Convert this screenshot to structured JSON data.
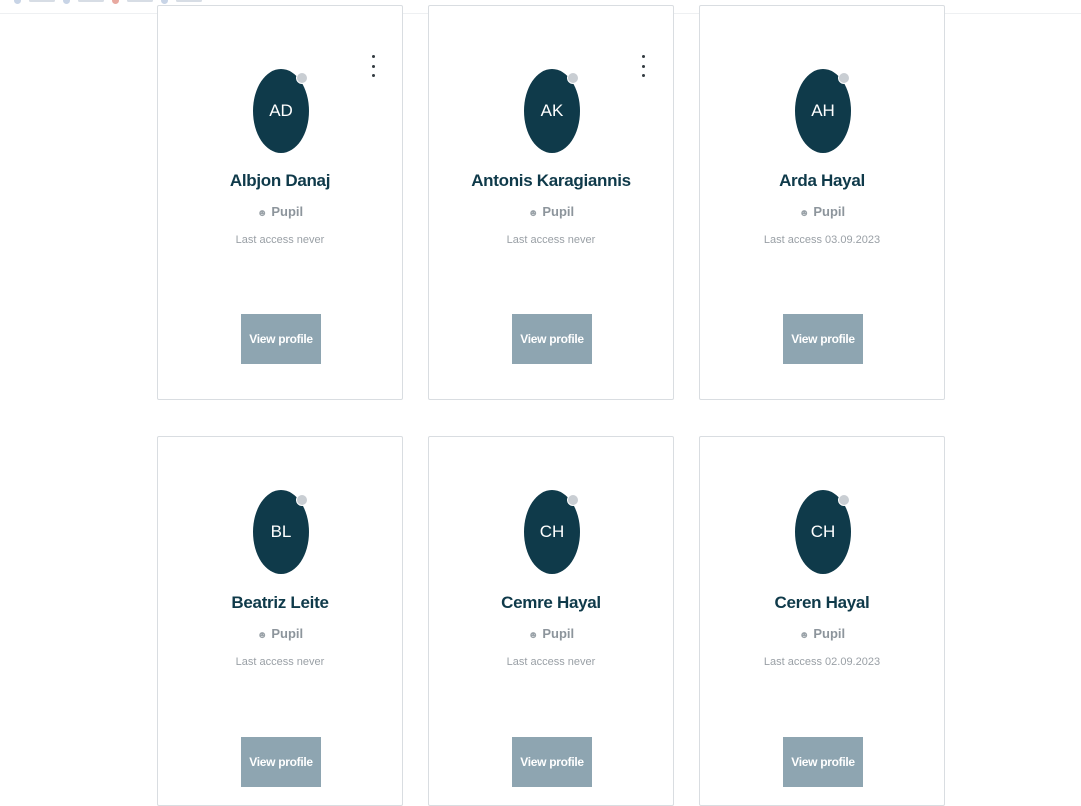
{
  "cards": [
    {
      "initials": "AD",
      "name": "Albjon Danaj",
      "role": "Pupil",
      "last_access": "Last access never",
      "button": "View profile",
      "has_menu": true
    },
    {
      "initials": "AK",
      "name": "Antonis Karagiannis",
      "role": "Pupil",
      "last_access": "Last access never",
      "button": "View profile",
      "has_menu": true
    },
    {
      "initials": "AH",
      "name": "Arda Hayal",
      "role": "Pupil",
      "last_access": "Last access 03.09.2023",
      "button": "View profile",
      "has_menu": false
    },
    {
      "initials": "BL",
      "name": "Beatriz Leite",
      "role": "Pupil",
      "last_access": "Last access never",
      "button": "View profile",
      "has_menu": false
    },
    {
      "initials": "CH",
      "name": "Cemre Hayal",
      "role": "Pupil",
      "last_access": "Last access never",
      "button": "View profile",
      "has_menu": false
    },
    {
      "initials": "CH",
      "name": "Ceren Hayal",
      "role": "Pupil",
      "last_access": "Last access 02.09.2023",
      "button": "View profile",
      "has_menu": false
    }
  ],
  "colors": {
    "avatar_bg": "#0f3a4a",
    "name_text": "#0f3a4a",
    "button_bg": "#8ea5b1",
    "status_dot": "#c9ced3"
  },
  "icons": {
    "role_icon": "user-icon",
    "menu_icon": "more-vertical-icon",
    "status_icon": "status-dot"
  }
}
